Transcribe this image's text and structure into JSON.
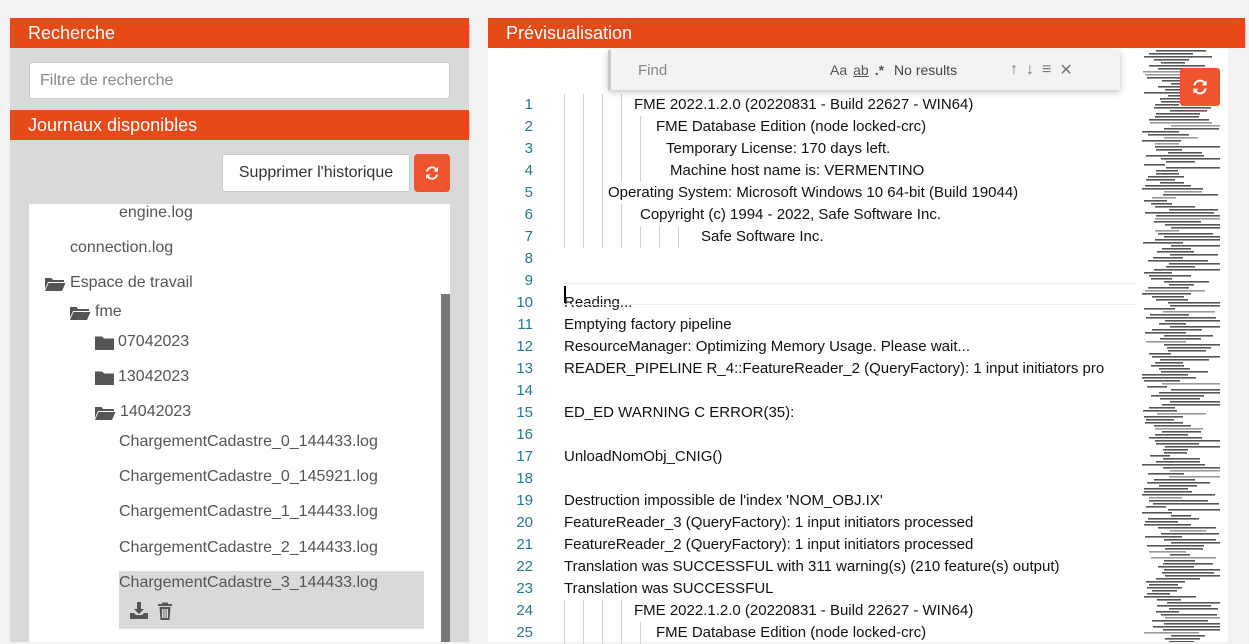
{
  "left": {
    "search_header": "Recherche",
    "search_placeholder": "Filtre de recherche",
    "journals_header": "Journaux disponibles",
    "clear_history": "Supprimer l'historique",
    "tree": {
      "engine_log": "engine.log",
      "connection_log": "connection.log",
      "workspace": "Espace de travail",
      "fme": "fme",
      "folder1": "07042023",
      "folder2": "13042023",
      "folder3": "14042023",
      "files": [
        "ChargementCadastre_0_144433.log",
        "ChargementCadastre_0_145921.log",
        "ChargementCadastre_1_144433.log",
        "ChargementCadastre_2_144433.log",
        "ChargementCadastre_3_144433.log"
      ]
    }
  },
  "right": {
    "header": "Prévisualisation",
    "find": {
      "placeholder": "Find",
      "match_case": "Aa",
      "whole_word": "ab",
      "regex": ".*",
      "result": "No results"
    },
    "lines": [
      {
        "n": "1",
        "t": "FME 2022.1.2.0 (20220831 - Build 22627 - WIN64)"
      },
      {
        "n": "2",
        "t": "FME Database Edition (node locked-crc)"
      },
      {
        "n": "3",
        "t": "Temporary License: 170 days left."
      },
      {
        "n": "4",
        "t": "Machine host name is: VERMENTINO"
      },
      {
        "n": "5",
        "t": "Operating System: Microsoft Windows 10 64-bit  (Build 19044)"
      },
      {
        "n": "6",
        "t": "Copyright (c) 1994 - 2022, Safe Software Inc."
      },
      {
        "n": "7",
        "t": "Safe Software Inc."
      },
      {
        "n": "8",
        "t": ""
      },
      {
        "n": "9",
        "t": ""
      },
      {
        "n": "10",
        "t": "Reading..."
      },
      {
        "n": "11",
        "t": "Emptying factory pipeline"
      },
      {
        "n": "12",
        "t": "ResourceManager: Optimizing Memory Usage.  Please wait..."
      },
      {
        "n": "13",
        "t": "READER_PIPELINE R_4::FeatureReader_2 (QueryFactory): 1 input initiators pro"
      },
      {
        "n": "14",
        "t": ""
      },
      {
        "n": "15",
        "t": "ED_ED WARNING C ERROR(35):"
      },
      {
        "n": "16",
        "t": ""
      },
      {
        "n": "17",
        "t": "UnloadNomObj_CNIG()"
      },
      {
        "n": "18",
        "t": ""
      },
      {
        "n": "19",
        "t": "Destruction impossible de l'index 'NOM_OBJ.IX'"
      },
      {
        "n": "20",
        "t": "FeatureReader_3 (QueryFactory): 1 input initiators processed"
      },
      {
        "n": "21",
        "t": "FeatureReader_2 (QueryFactory): 1 input initiators processed"
      },
      {
        "n": "22",
        "t": "Translation was SUCCESSFUL with 311 warning(s) (210 feature(s) output)"
      },
      {
        "n": "23",
        "t": "Translation was SUCCESSFUL"
      },
      {
        "n": "24",
        "t": "FME 2022.1.2.0 (20220831 - Build 22627 - WIN64)"
      },
      {
        "n": "25",
        "t": "FME Database Edition (node locked-crc)"
      }
    ]
  }
}
